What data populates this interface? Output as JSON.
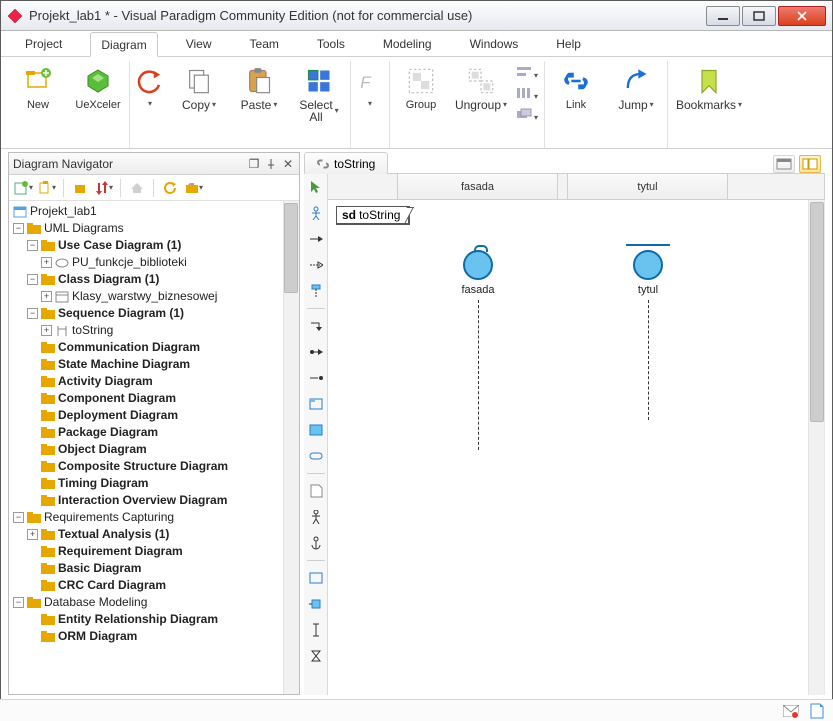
{
  "window": {
    "title": "Projekt_lab1 * - Visual Paradigm Community Edition (not for commercial use)"
  },
  "menu": {
    "items": [
      "Project",
      "Diagram",
      "View",
      "Team",
      "Tools",
      "Modeling",
      "Windows",
      "Help"
    ],
    "active_index": 1
  },
  "ribbon": {
    "new": "New",
    "uexceler": "UeXceler",
    "copy": "Copy",
    "paste": "Paste",
    "select_all": "Select\nAll",
    "group": "Group",
    "ungroup": "Ungroup",
    "link": "Link",
    "jump": "Jump",
    "bookmarks": "Bookmarks"
  },
  "navigator": {
    "title": "Diagram Navigator",
    "project": "Projekt_lab1",
    "uml_diagrams": "UML Diagrams",
    "use_case": "Use Case Diagram (1)",
    "use_case_child": "PU_funkcje_biblioteki",
    "class_diagram": "Class Diagram (1)",
    "class_child": "Klasy_warstwy_biznesowej",
    "sequence": "Sequence Diagram (1)",
    "sequence_child": "toString",
    "communication": "Communication Diagram",
    "state_machine": "State Machine Diagram",
    "activity": "Activity Diagram",
    "component": "Component Diagram",
    "deployment": "Deployment Diagram",
    "package": "Package Diagram",
    "object": "Object Diagram",
    "composite": "Composite Structure Diagram",
    "timing": "Timing Diagram",
    "interaction": "Interaction Overview Diagram",
    "requirements": "Requirements Capturing",
    "textual": "Textual Analysis (1)",
    "requirement": "Requirement Diagram",
    "basic": "Basic Diagram",
    "crc": "CRC Card Diagram",
    "database": "Database Modeling",
    "entity": "Entity Relationship Diagram",
    "orm": "ORM Diagram"
  },
  "canvas": {
    "tab": "toString",
    "header_cells": [
      "",
      "fasada",
      "",
      "tytul",
      ""
    ],
    "sd_label_prefix": "sd",
    "sd_label_name": "toString",
    "lifeline1": "fasada",
    "lifeline2": "tytul"
  }
}
